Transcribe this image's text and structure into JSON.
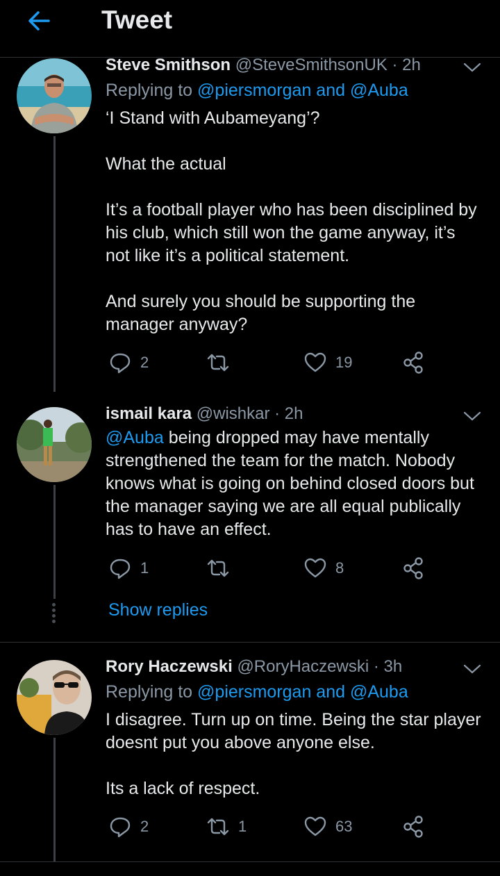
{
  "header": {
    "title": "Tweet"
  },
  "tweets": [
    {
      "name": "Steve Smithson",
      "handle": "@SteveSmithsonUK · 2h",
      "replying_prefix": "Replying to ",
      "replying_users": "@piersmorgan and @Auba",
      "paragraphs": [
        "‘I Stand with Aubameyang’?",
        "What the actual",
        "It’s a football player who has been disciplined by his club, which still won the game anyway, it’s not like it’s a political statement.",
        "And surely you should be supporting the manager anyway?"
      ],
      "replies": "2",
      "retweets": "",
      "likes": "19"
    },
    {
      "name": "ismail kara",
      "handle": "@wishkar · 2h",
      "mention": "@Auba",
      "text": " being dropped may have mentally strengthened the team for the match. Nobody knows what is going on behind closed doors but the manager saying we are all equal publically has to have an effect.",
      "replies": "1",
      "retweets": "",
      "likes": "8",
      "show_replies": "Show replies"
    },
    {
      "name": "Rory Haczewski",
      "handle": "@RoryHaczewski · 3h",
      "replying_prefix": "Replying to ",
      "replying_users": "@piersmorgan and @Auba",
      "paragraphs": [
        "I disagree. Turn up on time. Being the star player doesnt put you above anyone else.",
        "Its a lack of respect."
      ],
      "replies": "2",
      "retweets": "1",
      "likes": "63"
    }
  ],
  "icons": {
    "back": "arrow-left-icon",
    "reply": "reply-icon",
    "retweet": "retweet-icon",
    "like": "heart-icon",
    "share": "share-icon",
    "more": "chevron-down-icon"
  },
  "colors": {
    "accent": "#1d9bf0",
    "secondary_text": "#8b98a5",
    "background": "#000000"
  }
}
